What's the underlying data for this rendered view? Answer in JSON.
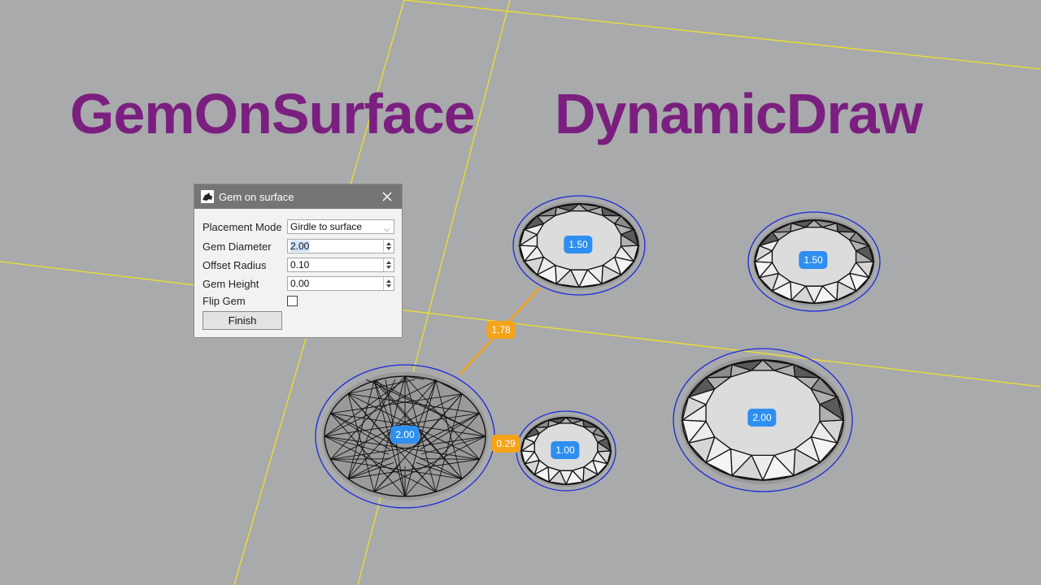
{
  "headline": {
    "left": "GemOnSurface",
    "right": "DynamicDraw"
  },
  "gems": [
    {
      "label": "2.00",
      "style": "wireframe"
    },
    {
      "label": "1.50",
      "style": "shaded"
    },
    {
      "label": "1.50",
      "style": "shaded"
    },
    {
      "label": "1.00",
      "style": "shaded"
    },
    {
      "label": "2.00",
      "style": "shaded"
    }
  ],
  "distances": [
    {
      "label": "1.78"
    },
    {
      "label": "0.29"
    }
  ],
  "dialog": {
    "title": "Gem on surface",
    "fields": {
      "placement_mode": {
        "label": "Placement Mode",
        "value": "Girdle to surface"
      },
      "gem_diameter": {
        "label": "Gem Diameter",
        "value": "2.00"
      },
      "offset_radius": {
        "label": "Offset Radius",
        "value": "0.10"
      },
      "gem_height": {
        "label": "Gem Height",
        "value": "0.00"
      },
      "flip_gem": {
        "label": "Flip Gem",
        "checked": false
      }
    },
    "finish_label": "Finish"
  },
  "colors": {
    "background": "#a9aaab",
    "headline": "#7a1f7f",
    "grid_line": "#f0e12a",
    "girdle_ring": "#1a2ad8",
    "tag_blue": "#2e8ff0",
    "tag_orange": "#f5a31a"
  },
  "icons": {
    "app": "rhino-icon",
    "close": "close-icon"
  }
}
